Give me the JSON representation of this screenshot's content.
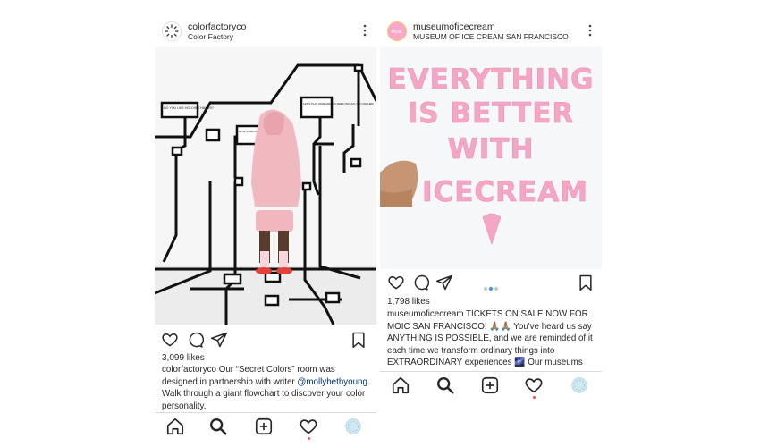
{
  "left_post": {
    "username": "colorfactoryco",
    "location": "Color Factory",
    "likes": "3,099 likes",
    "caption_user": "colorfactoryco",
    "caption_text_1": " Our “Secret Colors” room was designed in partnership with writer ",
    "caption_mention": "@mollybethyoung",
    "caption_text_2": ". Walk through a giant flowchart to discover your color personality.",
    "photo_signs": [
      "DO YOU LIKE HOLDING HANDS?",
      "LET'S PLAY HIDE AND GO SEEK! WOULD YOU RATHER",
      "HOW COMFORTABLE ARE YOU"
    ]
  },
  "right_post": {
    "username": "museumoficecream",
    "location": "MUSEUM OF ICE CREAM SAN FRANCISCO",
    "avatar_text": "MOIC",
    "photo_lines": [
      "EVERYTHING",
      "IS BETTER",
      "WITH",
      "ICECREAM"
    ],
    "likes": "1,798 likes",
    "caption_user": "museumoficecream",
    "caption_text": " TICKETS ON SALE NOW FOR MOIC SAN FRANCISCO! 🙏🏽🙏🏽 You've heard us say ANYTHING IS POSSIBLE, and we are reminded of it each time we transform ordinary things into EXTRAORDINARY experiences 🌌 Our museums start"
  },
  "icons": [
    "more-icon",
    "heart-icon",
    "comment-icon",
    "share-icon",
    "bookmark-icon",
    "home-icon",
    "search-icon",
    "add-icon",
    "activity-icon",
    "profile-icon"
  ],
  "colors": {
    "pink_letters": "#f4a6c5",
    "link_blue": "#003569",
    "pager_active": "#3897f0",
    "notification_red": "#ed4956"
  }
}
